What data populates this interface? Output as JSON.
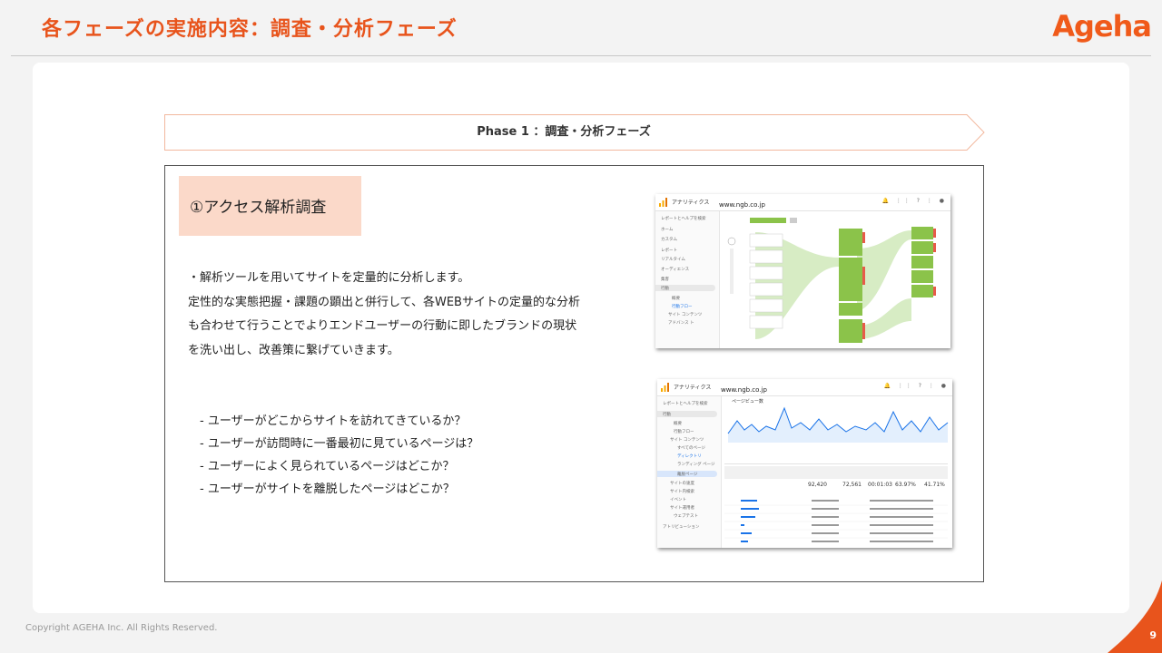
{
  "slide": {
    "title": "各フェーズの実施内容：調査・分析フェーズ",
    "logo": "Ageha",
    "phase_label": "Phase 1 ：調査・分析フェーズ",
    "section_title": "①アクセス解析調査",
    "description": [
      "・解析ツールを用いてサイトを定量的に分析します。",
      " 定性的な実態把握・課題の顕出と併行して、各WEBサイトの定量的な分析",
      "も合わせて行うことでよりエンドユーザーの行動に即したブランドの現状",
      "を洗い出し、改善策に繋げていきます。"
    ],
    "questions": [
      "- ユーザーがどこからサイトを訪れてきているか？",
      "- ユーザーが訪問時に一番最初に見ているページは？",
      "- ユーザーによく見られているページはどこか？",
      "- ユーザーがサイトを離脱したページはどこか？"
    ],
    "copyright": "Copyright AGEHA Inc. All Rights Reserved.",
    "page_number": "9"
  },
  "screenshots": {
    "flow": {
      "app": "アナリティクス",
      "site": "www.ngb.co.jp",
      "icons": "🔔 ⋮⋮ ? ⋮ ●",
      "sidebar": [
        "レポートとヘルプを検索",
        "ホーム",
        "カスタム",
        "レポート",
        "リアルタイム",
        "オーディエンス",
        "集客",
        "行動",
        "概要",
        "行動フロー",
        "サイト コンテンツ",
        "アドバンス ト"
      ]
    },
    "pageviews": {
      "app": "アナリティクス",
      "site": "www.ngb.co.jp",
      "icons": "🔔 ⋮⋮ ? ⋮ ●",
      "sidebar": [
        "レポートとヘルプを検索",
        "行動",
        "概要",
        "行動フロー",
        "サイト コンテンツ",
        "すべてのページ",
        "ディレクトリ",
        "ランディング ページ",
        "離脱ページ",
        "サイトの速度",
        "サイト内検索",
        "イベント",
        "サイト運用者",
        "ウェブテスト",
        "アトリビューション"
      ],
      "metric": "ページビュー数",
      "totals": [
        "92,420",
        "72,561",
        "00:01:03",
        "63.97%",
        "41.71%"
      ]
    }
  }
}
